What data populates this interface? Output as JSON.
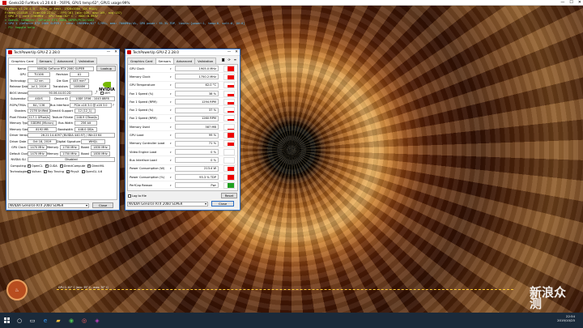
{
  "furmark": {
    "title": "Geeks3D FurMark v1.20.4.0 - 76FPS, GPU1 temp:62°, GPU1 usage:99%",
    "osd": [
      {
        "t": "FurMark v1.20.4.0 - Burn-in test, 1920x1080 (0X MSAA)",
        "c": "y"
      },
      {
        "t": "Frames:214549 - time:00:22:27 - FPS:161 (min:106, max:169, avg:157)",
        "c": "y"
      },
      {
        "t": "[ GPU-Z ] core:1905MHz - GPU temp:62° C - VDDC:0.993V",
        "c": "y"
      },
      {
        "t": "> OpenGL renderer: GeForce RTX 2060 SUPER/PCIe/SSE2",
        "c": "g"
      },
      {
        "t": "> GPU 1 (GeForce RTX 2060 SUPER) - core: 1905MHz/62° C/99%, mem: 7000MHz/4%, GPU power: 95.3% TDP, limits:[power:1, temp:0, volt:0, OV:0]",
        "c": "c"
      },
      {
        "t": "- F1: toggle help",
        "c": "g"
      }
    ],
    "gpu_line": "GPU 1: 62° C (min: 35° C - max: 70° C)"
  },
  "card": {
    "title": "TechPowerUp GPU-Z 2.28.0",
    "tabs": [
      "Graphics Card",
      "Sensors",
      "Advanced",
      "Validation"
    ],
    "name_label": "Name",
    "name": "NVIDIA GeForce RTX 2060 SUPER",
    "lookup": "Lookup",
    "gpu_label": "GPU",
    "gpu": "TU106",
    "rev_label": "Revision",
    "rev": "A1",
    "tech_label": "Technology",
    "tech": "12 nm",
    "die_label": "Die Size",
    "die": "445 mm²",
    "release_label": "Release Date",
    "release": "Jul 2, 2019",
    "trans_label": "Transistors",
    "trans": "10800M",
    "bios_label": "BIOS Version",
    "bios": "90.06.44.00.2D",
    "uefi": "UEFI",
    "sub_label": "Subvendor",
    "sub": "ASUS",
    "devid_label": "Device ID",
    "devid": "10DE 1F06 - 1043 8BF8",
    "rops_label": "ROPs/TMUs",
    "rops": "64 / 136",
    "bus_label": "Bus Interface",
    "bus": "PCIe x16 3.0 @ x16 3.0",
    "shaders_label": "Shaders",
    "shaders": "2176 Unified",
    "dx_label": "DirectX Support",
    "dx": "12 (12_1)",
    "pixel_label": "Pixel Fillrate",
    "pixel": "117.1 GPixel/s",
    "tex_label": "Texture Fillrate",
    "tex": "248.9 GTexel/s",
    "memtype_label": "Memory Type",
    "memtype": "GDDR6 (Micron)",
    "buswidth_label": "Bus Width",
    "buswidth": "256 bit",
    "memsize_label": "Memory Size",
    "memsize": "8192 MB",
    "bw_label": "Bandwidth",
    "bw": "448.0 GB/s",
    "driver_label": "Driver Version",
    "driver": "26.21.14.4097 (NVIDIA 440.97) / Win10 64",
    "ddate_label": "Driver Date",
    "ddate": "Oct 18, 2019",
    "dsig_label": "Digital Signature",
    "dsig": "WHQL",
    "gclk_label": "GPU Clock",
    "gclk": "1470 MHz",
    "mem_label": "Memory",
    "mclk": "1750 MHz",
    "boost_label": "Boost",
    "boost": "1830 MHz",
    "dclk_label": "Default Clock",
    "dclk": "1470 MHz",
    "dmclk": "1750 MHz",
    "dboost": "1830 MHz",
    "sli_label": "NVIDIA SLI",
    "sli": "Disabled",
    "comp_label": "Computing",
    "comp": [
      "OpenCL",
      "CUDA",
      "DirectCompute",
      "DirectML"
    ],
    "tech2_label": "Technologies",
    "tech2": [
      "Vulkan",
      "Ray Tracing",
      "PhysX",
      "OpenGL 4.6"
    ],
    "select": "NVIDIA GeForce RTX 2060 SUPER",
    "close": "Close",
    "vendor_logo": "NVIDIA"
  },
  "sensors": {
    "title": "TechPowerUp GPU-Z 2.28.0",
    "tabs": [
      "Graphics Card",
      "Sensors",
      "Advanced",
      "Validation"
    ],
    "rows": [
      {
        "name": "GPU Clock",
        "value": "1905.0 MHz",
        "level": 0.9
      },
      {
        "name": "Memory Clock",
        "value": "1750.2 MHz",
        "level": 0.9
      },
      {
        "name": "GPU Temperature",
        "value": "62.0 °C",
        "level": 0.55
      },
      {
        "name": "Fan 1 Speed (%)",
        "value": "38 %",
        "level": 0.4
      },
      {
        "name": "Fan 1 Speed (RPM)",
        "value": "1294 RPM",
        "level": 0.4
      },
      {
        "name": "Fan 2 Speed (%)",
        "value": "37 %",
        "level": 0.4
      },
      {
        "name": "Fan 2 Speed (RPM)",
        "value": "1260 RPM",
        "level": 0.4
      },
      {
        "name": "Memory Used",
        "value": "387 MB",
        "level": 0.05
      },
      {
        "name": "GPU Load",
        "value": "99 %",
        "level": 0.95
      },
      {
        "name": "Memory Controller Load",
        "value": "71 %",
        "level": 0.7
      },
      {
        "name": "Video Engine Load",
        "value": "0 %",
        "level": 0
      },
      {
        "name": "Bus Interface Load",
        "value": "0 %",
        "level": 0
      },
      {
        "name": "Power Consumption (W)",
        "value": "213.4 W",
        "level": 0.9
      },
      {
        "name": "Power Consumption (%)",
        "value": "95.3 % TDP",
        "level": 0.9
      },
      {
        "name": "PerfCap Reason",
        "value": "Pwr",
        "level": 1,
        "color": "#20a020"
      }
    ],
    "log": "Log to file",
    "reset": "Reset",
    "select": "NVIDIA GeForce RTX 2060 SUPER",
    "close": "Close"
  },
  "watermark": "新浪众测",
  "clock": {
    "time": "22:54",
    "date": "2019/10/25"
  }
}
